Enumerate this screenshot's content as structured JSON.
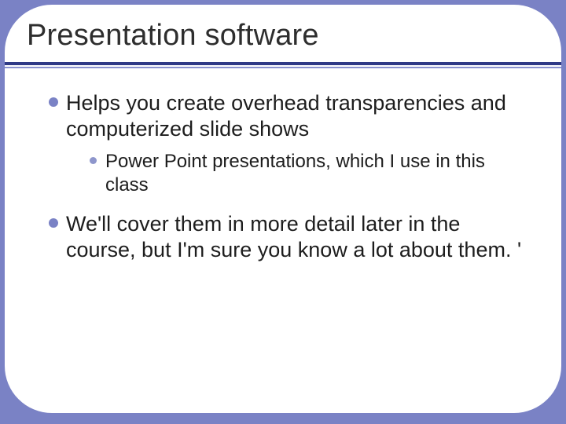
{
  "slide": {
    "title": "Presentation software",
    "bullets": [
      {
        "text": "Helps you create overhead transparencies and computerized slide shows",
        "children": [
          {
            "text": "Power Point presentations, which I use in this class"
          }
        ]
      },
      {
        "text": "We'll cover them in more detail later in the course, but I'm sure you know a lot about them. '",
        "children": []
      }
    ]
  },
  "colors": {
    "background": "#7a82c5",
    "accent_dark": "#2f3a86",
    "accent_light": "#8a92cf",
    "bullet": "#7a82c5"
  }
}
